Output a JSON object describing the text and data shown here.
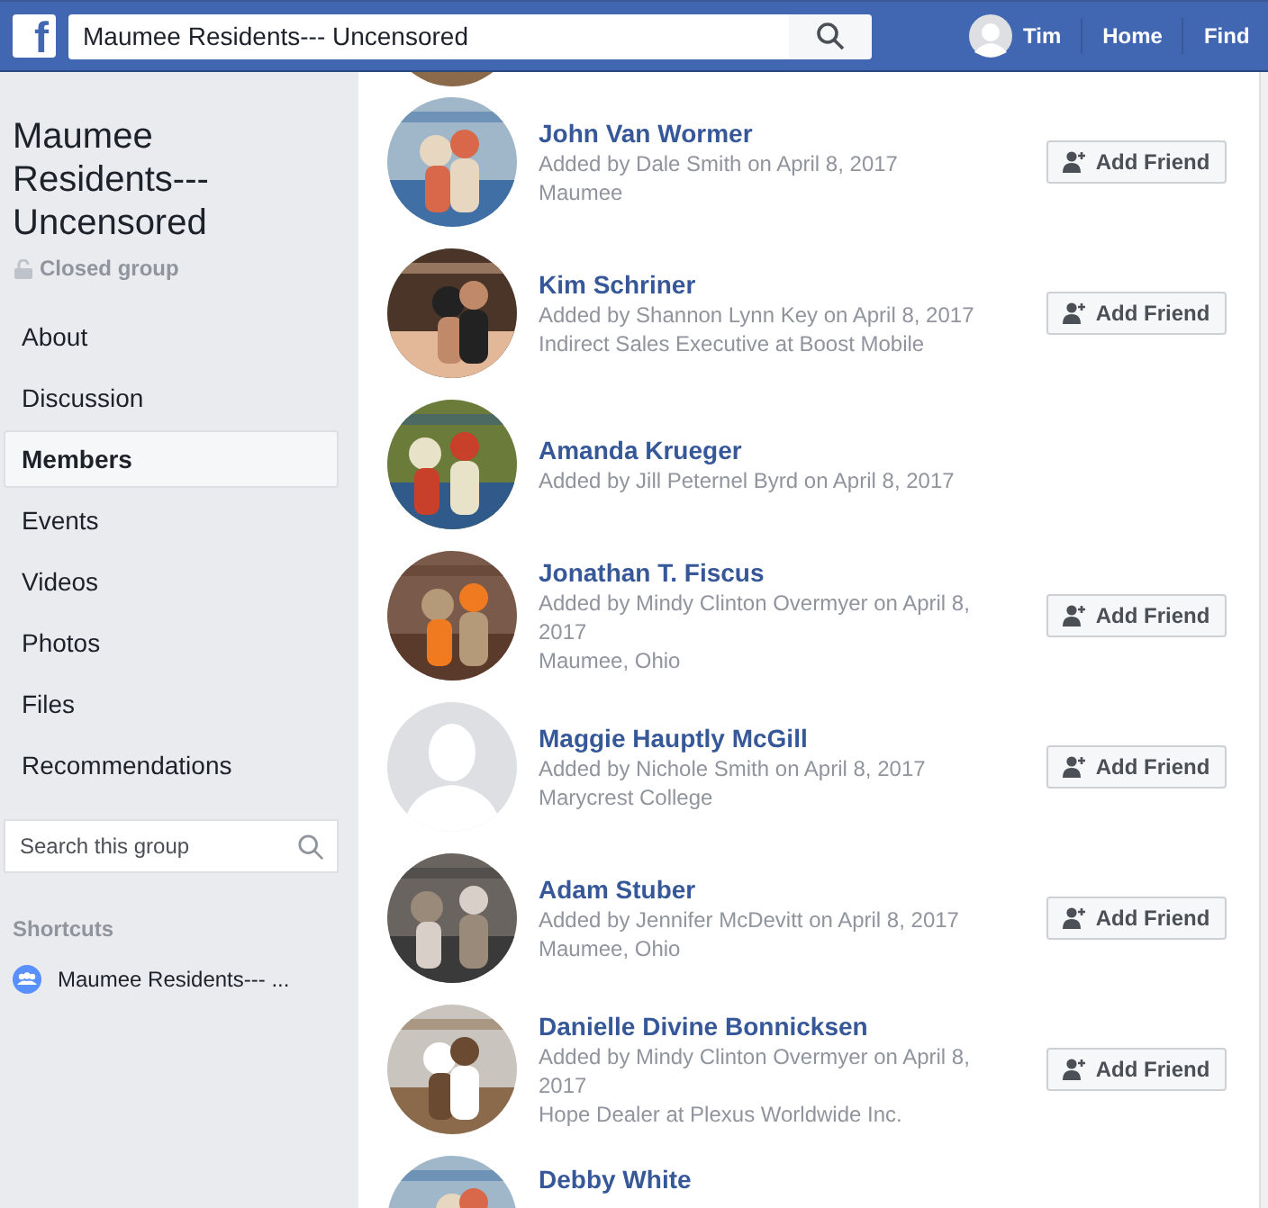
{
  "top_bar": {
    "logo": "f",
    "search": {
      "value": "Maumee Residents--- Uncensored"
    },
    "user": {
      "name": "Tim"
    },
    "nav": [
      "Home",
      "Find"
    ]
  },
  "sidebar": {
    "group_name": "Maumee Residents--- Uncensored",
    "privacy": "Closed group",
    "items": [
      {
        "label": "About",
        "selected": false
      },
      {
        "label": "Discussion",
        "selected": false
      },
      {
        "label": "Members",
        "selected": true
      },
      {
        "label": "Events",
        "selected": false
      },
      {
        "label": "Videos",
        "selected": false
      },
      {
        "label": "Photos",
        "selected": false
      },
      {
        "label": "Files",
        "selected": false
      },
      {
        "label": "Recommendations",
        "selected": false
      }
    ],
    "search": {
      "placeholder": "Search this group"
    },
    "shortcuts": {
      "heading": "Shortcuts",
      "items": [
        "Maumee Residents--- ..."
      ]
    }
  },
  "members": [
    {
      "kind": "picture"
    },
    {
      "kind": "picture",
      "name": "John Van Wormer",
      "added": "Added by Dale Smith on April 8, 2017",
      "details": [
        "Maumee"
      ],
      "button": "Add Friend"
    },
    {
      "kind": "picture",
      "name": "Kim Schriner",
      "added": "Added by Shannon Lynn Key on April 8, 2017",
      "details": [
        "Indirect Sales Executive at Boost Mobile"
      ],
      "button": "Add Friend"
    },
    {
      "kind": "picture",
      "name": "Amanda Krueger",
      "added": "Added by Jill Peternel Byrd on April 8, 2017"
    },
    {
      "kind": "picture",
      "name": "Jonathan T. Fiscus",
      "added": "Added by Mindy Clinton Overmyer on April 8, 2017",
      "details": [
        "Maumee, Ohio"
      ],
      "button": "Add Friend"
    },
    {
      "kind": "silhouette",
      "name": "Maggie Hauptly McGill",
      "added": "Added by Nichole Smith on April 8, 2017",
      "details": [
        "Marycrest College"
      ],
      "button": "Add Friend"
    },
    {
      "kind": "picture",
      "name": "Adam Stuber",
      "added": "Added by Jennifer McDevitt on April 8, 2017",
      "details": [
        "Maumee, Ohio"
      ],
      "button": "Add Friend"
    },
    {
      "kind": "picture",
      "name": "Danielle Divine Bonnicksen",
      "added": "Added by Mindy Clinton Overmyer on April 8, 2017",
      "details": [
        "Hope Dealer at Plexus Worldwide Inc."
      ],
      "button": "Add Friend"
    },
    {
      "kind": "picture",
      "name": "Debby White"
    }
  ]
}
